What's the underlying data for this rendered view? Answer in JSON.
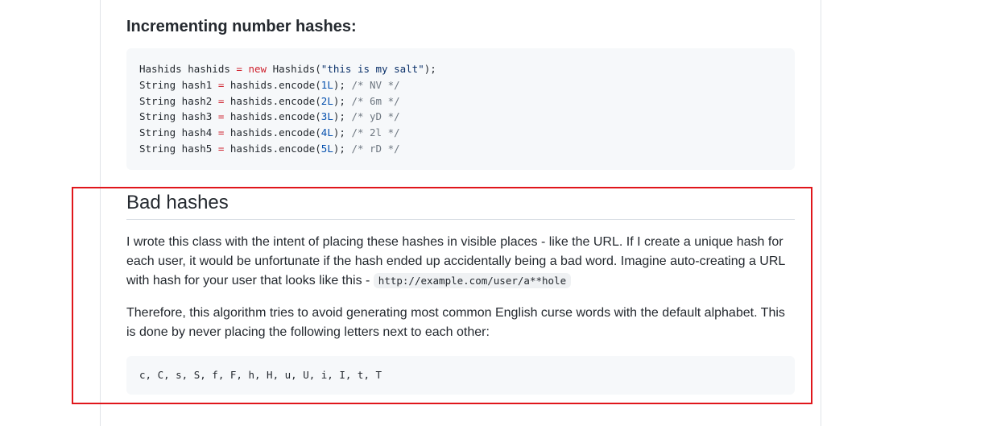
{
  "section_incrementing": {
    "title": "Incrementing number hashes:",
    "code_lines": [
      [
        {
          "t": "plain",
          "v": "Hashids hashids "
        },
        {
          "t": "op",
          "v": "="
        },
        {
          "t": "plain",
          "v": " "
        },
        {
          "t": "kw",
          "v": "new"
        },
        {
          "t": "plain",
          "v": " Hashids("
        },
        {
          "t": "str",
          "v": "\"this is my salt\""
        },
        {
          "t": "plain",
          "v": ");"
        }
      ],
      [
        {
          "t": "plain",
          "v": "String hash1 "
        },
        {
          "t": "op",
          "v": "="
        },
        {
          "t": "plain",
          "v": " hashids.encode("
        },
        {
          "t": "num",
          "v": "1L"
        },
        {
          "t": "plain",
          "v": "); "
        },
        {
          "t": "com",
          "v": "/* NV */"
        }
      ],
      [
        {
          "t": "plain",
          "v": "String hash2 "
        },
        {
          "t": "op",
          "v": "="
        },
        {
          "t": "plain",
          "v": " hashids.encode("
        },
        {
          "t": "num",
          "v": "2L"
        },
        {
          "t": "plain",
          "v": "); "
        },
        {
          "t": "com",
          "v": "/* 6m */"
        }
      ],
      [
        {
          "t": "plain",
          "v": "String hash3 "
        },
        {
          "t": "op",
          "v": "="
        },
        {
          "t": "plain",
          "v": " hashids.encode("
        },
        {
          "t": "num",
          "v": "3L"
        },
        {
          "t": "plain",
          "v": "); "
        },
        {
          "t": "com",
          "v": "/* yD */"
        }
      ],
      [
        {
          "t": "plain",
          "v": "String hash4 "
        },
        {
          "t": "op",
          "v": "="
        },
        {
          "t": "plain",
          "v": " hashids.encode("
        },
        {
          "t": "num",
          "v": "4L"
        },
        {
          "t": "plain",
          "v": "); "
        },
        {
          "t": "com",
          "v": "/* 2l */"
        }
      ],
      [
        {
          "t": "plain",
          "v": "String hash5 "
        },
        {
          "t": "op",
          "v": "="
        },
        {
          "t": "plain",
          "v": " hashids.encode("
        },
        {
          "t": "num",
          "v": "5L"
        },
        {
          "t": "plain",
          "v": "); "
        },
        {
          "t": "com",
          "v": "/* rD */"
        }
      ]
    ]
  },
  "section_bad": {
    "title": "Bad hashes",
    "para1_text": "I wrote this class with the intent of placing these hashes in visible places - like the URL. If I create a unique hash for each user, it would be unfortunate if the hash ended up accidentally being a bad word. Imagine auto-creating a URL with hash for your user that looks like this - ",
    "para1_code": "http://example.com/user/a**hole",
    "para2_text": "Therefore, this algorithm tries to avoid generating most common English curse words with the default alphabet. This is done by never placing the following letters next to each other:",
    "letters_code": "c, C, s, S, f, F, h, H, u, U, i, I, t, T"
  },
  "colors": {
    "highlight_border": "#e0161b",
    "code_background": "#f6f8fa"
  }
}
